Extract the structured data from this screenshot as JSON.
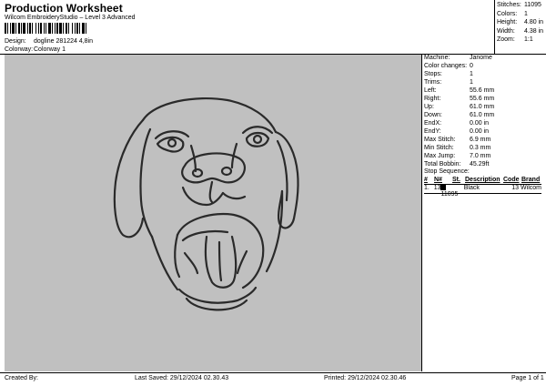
{
  "header": {
    "title": "Production Worksheet",
    "subtitle": "Wilcom EmbroideryStudio – Level 3 Advanced"
  },
  "design": {
    "label": "Design:",
    "value": "dogline 281224 4,8in"
  },
  "colorway": {
    "label": "Colorway:",
    "value": "Colorway 1"
  },
  "stats": [
    {
      "label": "Stitches:",
      "value": "11095"
    },
    {
      "label": "Colors:",
      "value": "1"
    },
    {
      "label": "Height:",
      "value": "4.80 in"
    },
    {
      "label": "Width:",
      "value": "4.38 in"
    },
    {
      "label": "Zoom:",
      "value": "1:1"
    }
  ],
  "info": [
    {
      "label": "Machine:",
      "value": "Janome"
    },
    {
      "label": "Color changes:",
      "value": "0"
    },
    {
      "label": "Stops:",
      "value": "1"
    },
    {
      "label": "Trims:",
      "value": "1"
    },
    {
      "label": "Left:",
      "value": "55.6 mm"
    },
    {
      "label": "Right:",
      "value": "55.6 mm"
    },
    {
      "label": "Up:",
      "value": "61.0 mm"
    },
    {
      "label": "Down:",
      "value": "61.0 mm"
    },
    {
      "label": "EndX:",
      "value": "0.00 in"
    },
    {
      "label": "EndY:",
      "value": "0.00 in"
    },
    {
      "label": "Max Stitch:",
      "value": "6.9 mm"
    },
    {
      "label": "Min Stitch:",
      "value": "0.3 mm"
    },
    {
      "label": "Max Jump:",
      "value": "7.0 mm"
    },
    {
      "label": "Total Bobbin:",
      "value": "45.29ft"
    }
  ],
  "stop_sequence": {
    "title": "Stop Sequence:",
    "headers": [
      "#",
      "N#",
      "St.",
      "Description",
      "Code",
      "Brand"
    ],
    "rows": [
      {
        "num": "1.",
        "n": "13",
        "st": "11095",
        "desc": "Black",
        "code": "13",
        "brand": "Wilcom"
      }
    ]
  },
  "footer": {
    "created": "Created By:",
    "last_saved": "Last Saved: 29/12/2024 02.30.43",
    "printed": "Printed: 29/12/2024 02.30.46",
    "page": "Page 1 of 1"
  },
  "colors": {
    "canvas_bg": "#c0c0c0",
    "thread": "#2a2a2a"
  }
}
